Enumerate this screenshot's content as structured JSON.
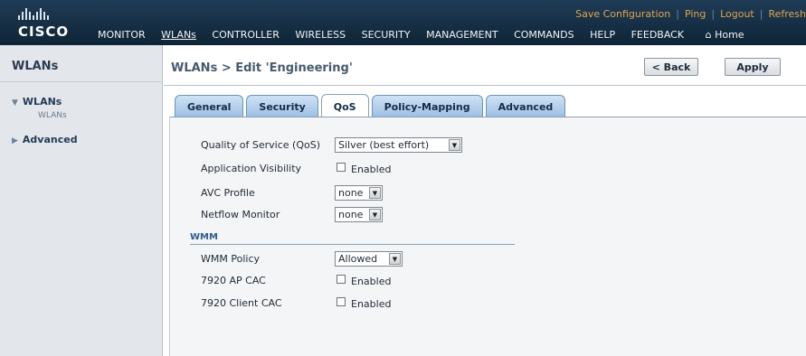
{
  "brand": {
    "logo_text": "CISCO"
  },
  "util_links": [
    "Save Configuration",
    "Ping",
    "Logout",
    "Refresh"
  ],
  "nav": {
    "items": [
      "MONITOR",
      "WLANs",
      "CONTROLLER",
      "WIRELESS",
      "SECURITY",
      "MANAGEMENT",
      "COMMANDS",
      "HELP",
      "FEEDBACK"
    ],
    "active": "WLANs",
    "home": "Home"
  },
  "sidebar": {
    "title": "WLANs",
    "items": [
      {
        "label": "WLANs",
        "expanded": true,
        "sub": [
          "WLANs"
        ]
      },
      {
        "label": "Advanced",
        "expanded": false
      }
    ]
  },
  "page": {
    "title": "WLANs > Edit  'Engineering'",
    "back_label": "< Back",
    "apply_label": "Apply"
  },
  "tabs": [
    {
      "label": "General",
      "active": false
    },
    {
      "label": "Security",
      "active": false
    },
    {
      "label": "QoS",
      "active": true
    },
    {
      "label": "Policy-Mapping",
      "active": false
    },
    {
      "label": "Advanced",
      "active": false
    }
  ],
  "form": {
    "qos_label": "Quality of Service (QoS)",
    "qos_value": "Silver (best effort)",
    "app_visibility_label": "Application Visibility",
    "app_visibility_checked": false,
    "enabled_text": "Enabled",
    "avc_profile_label": "AVC Profile",
    "avc_profile_value": "none",
    "netflow_label": "Netflow Monitor",
    "netflow_value": "none",
    "wmm_section": "WMM",
    "wmm_policy_label": "WMM Policy",
    "wmm_policy_value": "Allowed",
    "ap_cac_label": "7920 AP CAC",
    "ap_cac_checked": false,
    "client_cac_label": "7920 Client CAC",
    "client_cac_checked": false
  },
  "colors": {
    "topbar": "#1f3c56",
    "util_link": "#e0a451",
    "tab_blue": "#9bbfe2",
    "section_label": "#2c5d8b"
  }
}
